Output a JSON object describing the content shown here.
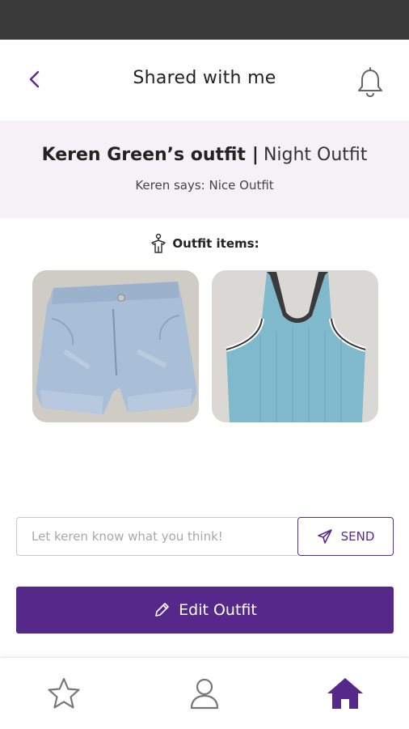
{
  "header": {
    "title": "Shared with me",
    "back_icon": "chevron-left-icon",
    "bell_icon": "bell-icon"
  },
  "outfit": {
    "owner_title": "Keren Green’s outfit",
    "separator": "|",
    "name": "Night Outfit",
    "message": "Keren says: Nice Outfit"
  },
  "items_section": {
    "heading": "Outfit items:",
    "icon": "hanger-icon",
    "items": [
      {
        "name": "denim-shorts-image"
      },
      {
        "name": "blue-tank-top-image"
      }
    ]
  },
  "comment": {
    "placeholder": "Let keren know what you think!",
    "value": "",
    "send_label": "SEND",
    "send_icon": "paper-plane-icon"
  },
  "edit_button": {
    "label": "Edit Outfit",
    "icon": "pencil-icon"
  },
  "bottom_nav": {
    "items": [
      {
        "icon": "star-icon",
        "active": false
      },
      {
        "icon": "user-icon",
        "active": false
      },
      {
        "icon": "home-icon",
        "active": true
      }
    ]
  },
  "colors": {
    "accent": "#56288a",
    "status_bar": "#3a3a3a",
    "banner_bg": "#f4f2f7"
  }
}
